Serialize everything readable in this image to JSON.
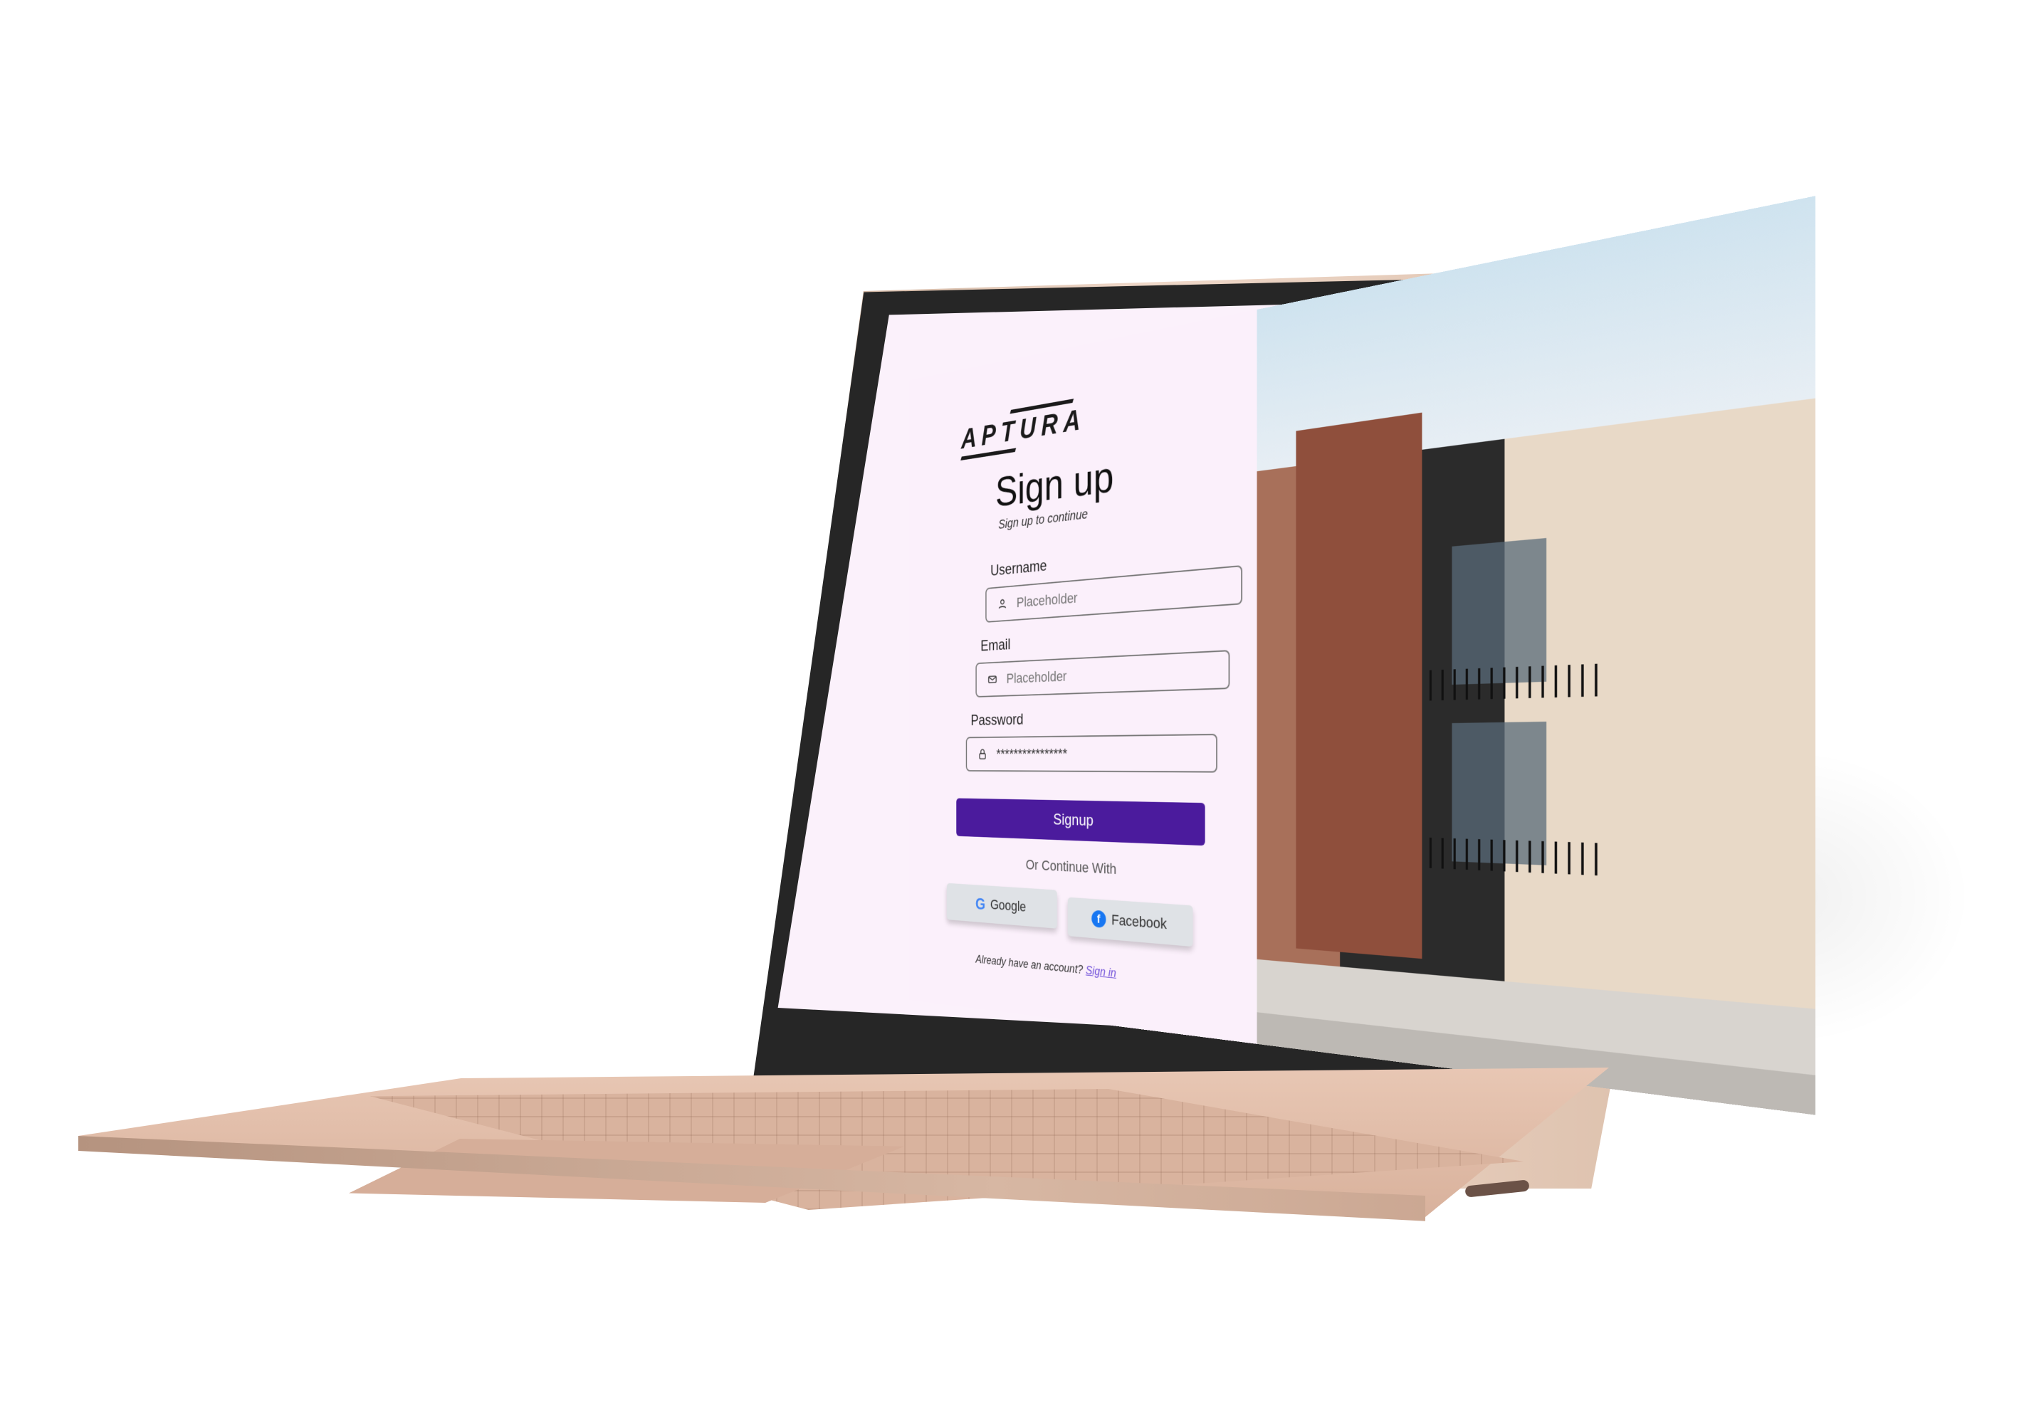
{
  "brand": {
    "logo_text": "APTURA"
  },
  "signup": {
    "title": "Sign up",
    "subtitle": "Sign up to continue",
    "fields": {
      "username": {
        "label": "Username",
        "placeholder": "Placeholder",
        "icon": "user-icon"
      },
      "email": {
        "label": "Email",
        "placeholder": "Placeholder",
        "icon": "mail-icon"
      },
      "password": {
        "label": "Password",
        "value": "****************",
        "icon": "lock-icon"
      }
    },
    "primary_action": "Signup",
    "divider_text": "Or Continue With",
    "social": {
      "google": "Google",
      "facebook": "Facebook"
    },
    "footer": {
      "text": "Already have an account?",
      "link": "Sign in"
    }
  },
  "colors": {
    "primary": "#4b1b9d",
    "panel_bg": "#fbf0fb",
    "link": "#6b4bd8"
  }
}
